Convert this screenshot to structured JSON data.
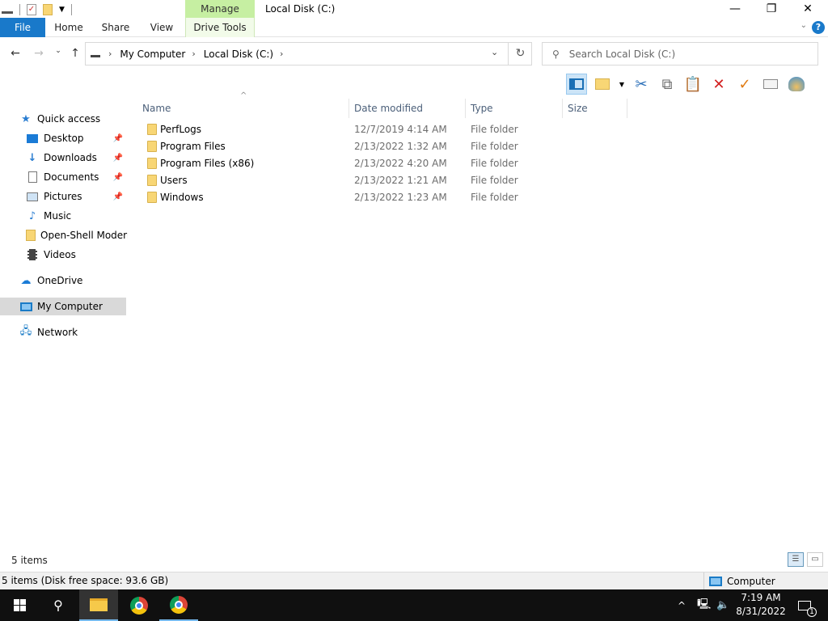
{
  "window": {
    "title": "Local Disk (C:)",
    "context_tab": "Manage",
    "minimize": "—",
    "restore": "❐",
    "close": "✕"
  },
  "ribbon": {
    "tabs": [
      {
        "label": "File"
      },
      {
        "label": "Home"
      },
      {
        "label": "Share"
      },
      {
        "label": "View"
      },
      {
        "label": "Drive Tools"
      }
    ],
    "help": "?"
  },
  "address": {
    "crumbs": [
      "My Computer",
      "Local Disk (C:)"
    ],
    "search_placeholder": "Search Local Disk (C:)"
  },
  "navpane": {
    "items": [
      {
        "label": "Quick access",
        "icon": "star-icon"
      },
      {
        "label": "Desktop",
        "icon": "desktop-icon",
        "pinned": true
      },
      {
        "label": "Downloads",
        "icon": "download-icon",
        "pinned": true
      },
      {
        "label": "Documents",
        "icon": "document-icon",
        "pinned": true
      },
      {
        "label": "Pictures",
        "icon": "picture-icon",
        "pinned": true
      },
      {
        "label": "Music",
        "icon": "music-icon"
      },
      {
        "label": "Open-Shell Modern",
        "icon": "folder-icon"
      },
      {
        "label": "Videos",
        "icon": "video-icon"
      },
      {
        "label": "OneDrive",
        "icon": "cloud-icon"
      },
      {
        "label": "My Computer",
        "icon": "computer-icon",
        "selected": true
      },
      {
        "label": "Network",
        "icon": "network-icon"
      }
    ]
  },
  "columns": {
    "name": "Name",
    "date": "Date modified",
    "type": "Type",
    "size": "Size"
  },
  "files": [
    {
      "name": "PerfLogs",
      "date": "12/7/2019 4:14 AM",
      "type": "File folder"
    },
    {
      "name": "Program Files",
      "date": "2/13/2022 1:32 AM",
      "type": "File folder"
    },
    {
      "name": "Program Files (x86)",
      "date": "2/13/2022 4:20 AM",
      "type": "File folder"
    },
    {
      "name": "Users",
      "date": "2/13/2022 1:21 AM",
      "type": "File folder"
    },
    {
      "name": "Windows",
      "date": "2/13/2022 1:23 AM",
      "type": "File folder"
    }
  ],
  "status": {
    "item_count": "5 items",
    "detail": "5 items (Disk free space: 93.6 GB)",
    "location": "Computer"
  },
  "taskbar": {
    "time": "7:19 AM",
    "date": "8/31/2022",
    "notification_count": "1"
  },
  "colors": {
    "accent": "#1979ca",
    "manage_tab": "#c6efa2",
    "selection": "#d9d9d9"
  }
}
